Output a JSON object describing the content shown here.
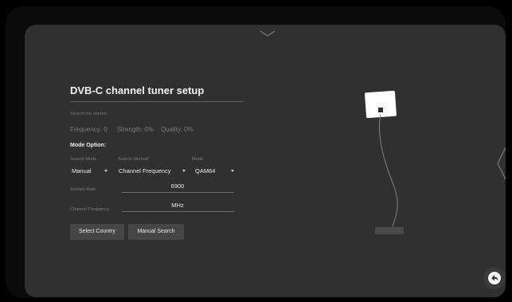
{
  "panel": {
    "title": "DVB-C channel tuner setup",
    "status": "Search not started",
    "frequency_text": "Frequency: 0",
    "strength_text": "Strength: 0%",
    "quality_text": "Quality: 0%",
    "mode_option_label": "Mode Option:"
  },
  "fields": {
    "search_mode": {
      "label": "Search Mode",
      "value": "Manual"
    },
    "search_method": {
      "label": "Search Method:",
      "value": "Channel Frequency"
    },
    "modulation": {
      "label": "Mode:",
      "value": "QAM64"
    },
    "symbol_rate": {
      "label": "Symbol Rate:",
      "value": "6900"
    },
    "channel_frequency": {
      "label": "Channel Frequency:",
      "value": "MHz"
    }
  },
  "buttons": {
    "select_country": "Select Country",
    "manual_search": "Manual Search"
  },
  "icons": {
    "pull_down": "chevron-down-icon",
    "side_handle": "chevron-left-icon",
    "back": "back-arrow-icon",
    "antenna": "antenna-illustration"
  }
}
